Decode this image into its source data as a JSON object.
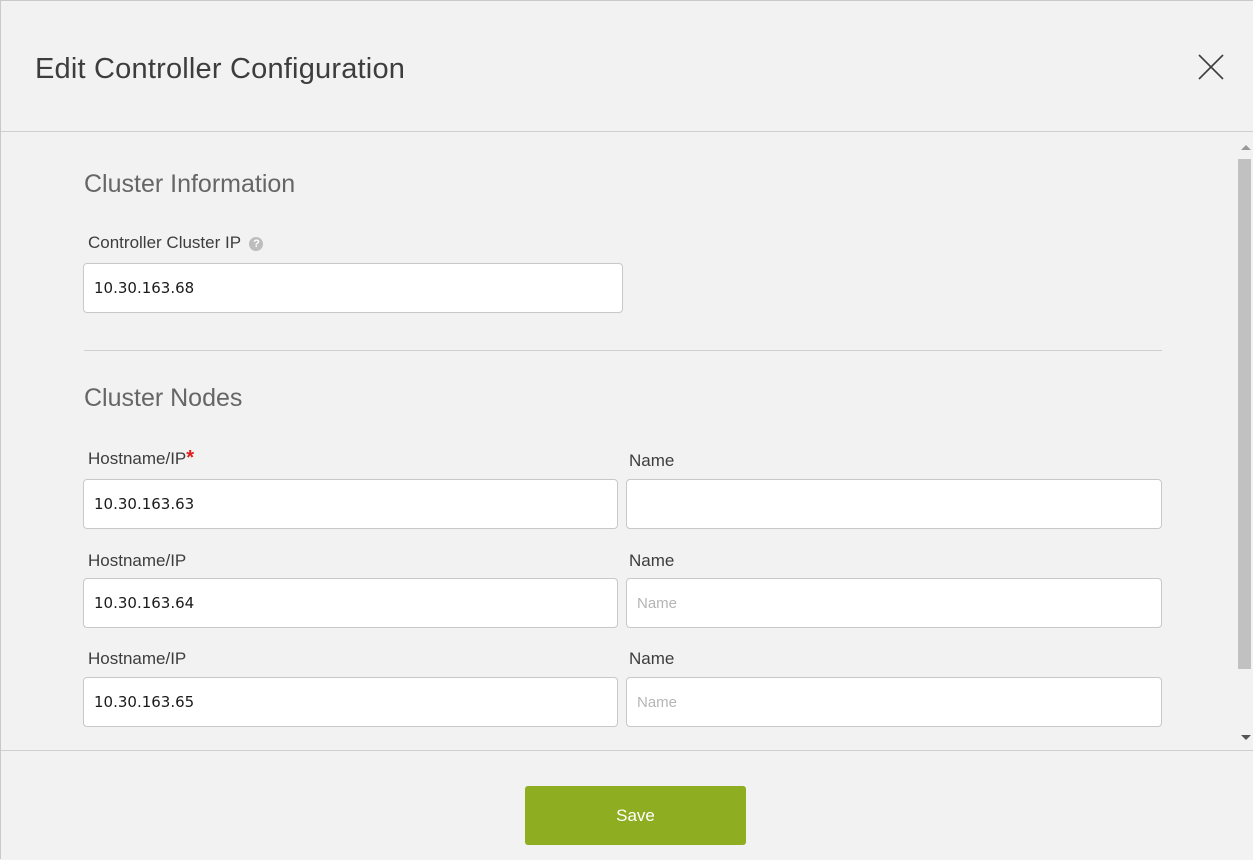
{
  "modal": {
    "title": "Edit Controller Configuration",
    "close_icon": "close-icon"
  },
  "cluster_info": {
    "section_title": "Cluster Information",
    "ip_label": "Controller Cluster IP",
    "help_icon": "question-circle-icon",
    "ip_value": "10.30.163.68"
  },
  "cluster_nodes": {
    "section_title": "Cluster Nodes",
    "nodes": [
      {
        "hostname_label": "Hostname/IP",
        "required": "*",
        "hostname_value": "10.30.163.63",
        "name_label": "Name",
        "name_value": "",
        "name_placeholder": ""
      },
      {
        "hostname_label": "Hostname/IP",
        "required": "",
        "hostname_value": "10.30.163.64",
        "name_label": "Name",
        "name_value": "",
        "name_placeholder": "Name"
      },
      {
        "hostname_label": "Hostname/IP",
        "required": "",
        "hostname_value": "10.30.163.65",
        "name_label": "Name",
        "name_value": "",
        "name_placeholder": "Name"
      }
    ]
  },
  "footer": {
    "save_label": "Save"
  },
  "colors": {
    "save_button": "#8fad20",
    "required_star": "#e01b1b"
  }
}
